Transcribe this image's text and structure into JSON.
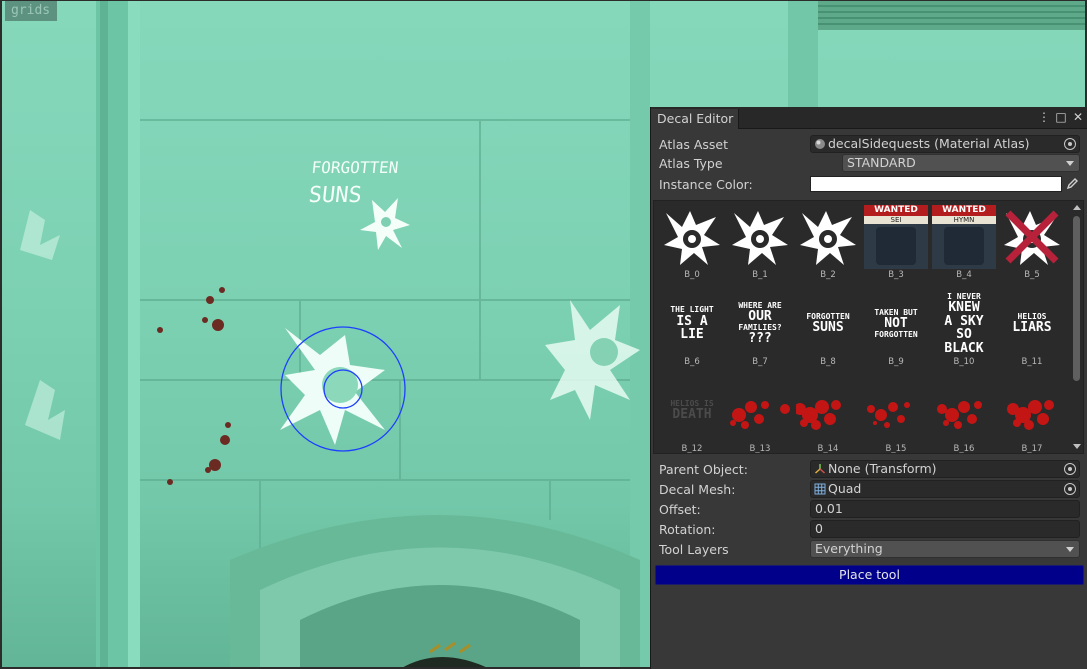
{
  "scene": {
    "overlay_label": "grids",
    "wall_text_1": "FORGOTTEN",
    "wall_text_2": "SUNS"
  },
  "decal_editor": {
    "tab_title": "Decal Editor",
    "window_buttons": {
      "menu": "⋮",
      "maximize": "□",
      "close": "✕"
    },
    "atlas_asset": {
      "label": "Atlas Asset",
      "value": "decalSidequests (Material Atlas)",
      "icon": "material-icon"
    },
    "atlas_type": {
      "label": "Atlas Type",
      "value": "STANDARD"
    },
    "instance_color": {
      "label": "Instance Color:",
      "value": "#ffffff",
      "icon": "eyedropper-icon"
    },
    "decals": [
      {
        "name": "B_0",
        "kind": "sun"
      },
      {
        "name": "B_1",
        "kind": "sun"
      },
      {
        "name": "B_2",
        "kind": "sun"
      },
      {
        "name": "B_3",
        "kind": "poster",
        "header": "WANTED",
        "sub": "SEI"
      },
      {
        "name": "B_4",
        "kind": "poster",
        "header": "WANTED",
        "sub": "HYMN"
      },
      {
        "name": "B_5",
        "kind": "crossed-sun"
      },
      {
        "name": "B_6",
        "kind": "text",
        "lines": [
          "THE LIGHT",
          "IS A",
          "LIE"
        ]
      },
      {
        "name": "B_7",
        "kind": "text",
        "lines": [
          "WHERE ARE",
          "OUR",
          "FAMILIES?",
          "???"
        ]
      },
      {
        "name": "B_8",
        "kind": "text",
        "lines": [
          "FORGOTTEN",
          "SUNS"
        ]
      },
      {
        "name": "B_9",
        "kind": "text",
        "lines": [
          "TAKEN BUT",
          "NOT",
          "FORGOTTEN"
        ]
      },
      {
        "name": "B_10",
        "kind": "text",
        "lines": [
          "I NEVER",
          "KNEW",
          "A SKY",
          "SO",
          "BLACK"
        ]
      },
      {
        "name": "B_11",
        "kind": "text",
        "lines": [
          "HELIOS",
          "LIARS"
        ]
      },
      {
        "name": "B_12",
        "kind": "text",
        "lines": [
          "HELIOS IS",
          "DEATH"
        ]
      },
      {
        "name": "B_13",
        "kind": "blood"
      },
      {
        "name": "B_14",
        "kind": "blood"
      },
      {
        "name": "B_15",
        "kind": "blood"
      },
      {
        "name": "B_16",
        "kind": "blood"
      },
      {
        "name": "B_17",
        "kind": "blood"
      }
    ],
    "parent_object": {
      "label": "Parent Object:",
      "value": "None (Transform)",
      "icon": "transform-icon"
    },
    "decal_mesh": {
      "label": "Decal Mesh:",
      "value": "Quad",
      "icon": "mesh-icon"
    },
    "offset": {
      "label": "Offset:",
      "value": "0.01"
    },
    "rotation": {
      "label": "Rotation:",
      "value": "0"
    },
    "tool_layers": {
      "label": "Tool Layers",
      "value": "Everything"
    },
    "place_button": "Place tool",
    "colors": {
      "place_button_bg": "#00008b",
      "panel_bg": "#383838",
      "field_bg": "#2a2a2a"
    }
  }
}
